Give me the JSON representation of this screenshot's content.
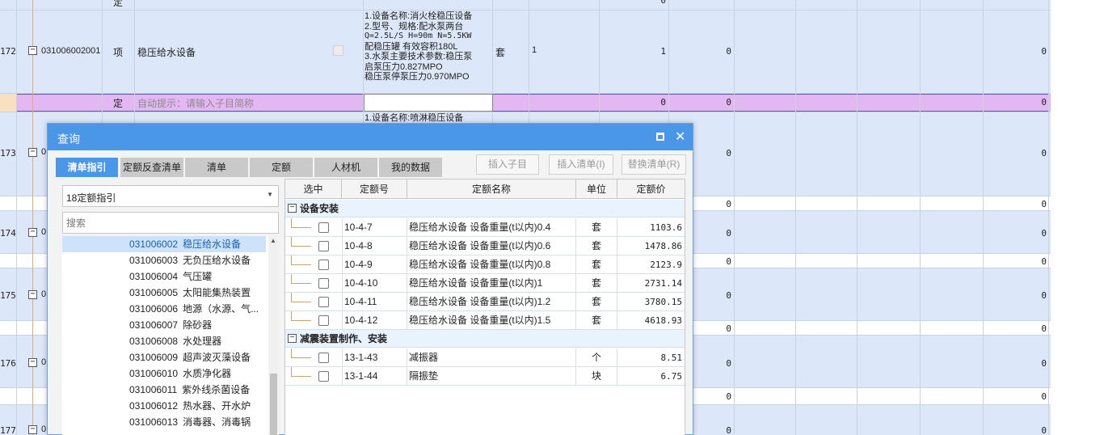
{
  "sheet": {
    "rows": [
      {
        "rownum": "172",
        "code": "031006002001",
        "type": "项",
        "name": "稳压给水设备",
        "unit": "套",
        "qty_expr": "1",
        "qty": "1",
        "price": "0",
        "total": "0",
        "desc": [
          "1.设备名称:消火栓稳压设备",
          "2.型号、规格:配水泵两台",
          "Q=2.5L/S H=90m N=5.5KW",
          "配稳压罐 有效容积180L",
          "3.水泵主要技术参数:稳压泵",
          "启泵压力0.827MPO",
          "稳压泵停泵压力0.970MPO"
        ]
      },
      {
        "type": "定",
        "hint": "自动提示：请输入子目简称",
        "qty": "0",
        "price": "0",
        "total": "0"
      },
      {
        "rownum": "173",
        "code": "0",
        "desc": [
          "1.设备名称:喷淋稳压设备"
        ],
        "price": "0",
        "total": "0"
      },
      {
        "rownum": "174",
        "code": "0",
        "price": "0",
        "total": "0"
      },
      {
        "rownum": "175",
        "code": "0",
        "price": "0",
        "total": "0"
      },
      {
        "rownum": "176",
        "code": "0",
        "price": "0",
        "total": "0"
      },
      {
        "rownum": "177",
        "code": "0",
        "price": "0",
        "total": "0"
      }
    ],
    "top_partial_type": "定",
    "top_zero": "0",
    "sub_zero": "0"
  },
  "dialog": {
    "title": "查询",
    "tabs": [
      "清单指引",
      "定额反查清单",
      "清单",
      "定额",
      "人材机",
      "我的数据"
    ],
    "buttons": [
      "插入子目",
      "插入清单(I)",
      "替换清单(R)"
    ],
    "combo_value": "18定额指引",
    "search_placeholder": "搜索",
    "tree_items": [
      {
        "code": "031006002",
        "name": "稳压给水设备"
      },
      {
        "code": "031006003",
        "name": "无负压给水设备"
      },
      {
        "code": "031006004",
        "name": "气压罐"
      },
      {
        "code": "031006005",
        "name": "太阳能集热装置"
      },
      {
        "code": "031006006",
        "name": "地源（水源、气..."
      },
      {
        "code": "031006007",
        "name": "除砂器"
      },
      {
        "code": "031006008",
        "name": "水处理器"
      },
      {
        "code": "031006009",
        "name": "超声波灭藻设备"
      },
      {
        "code": "031006010",
        "name": "水质净化器"
      },
      {
        "code": "031006011",
        "name": "紫外线杀菌设备"
      },
      {
        "code": "031006012",
        "name": "热水器、开水炉"
      },
      {
        "code": "031006013",
        "name": "消毒器、消毒锅"
      }
    ],
    "grid": {
      "headers": [
        "选中",
        "定额号",
        "定额名称",
        "单位",
        "定额价"
      ],
      "groups": [
        {
          "name": "设备安装",
          "rows": [
            {
              "code": "10-4-7",
              "name": "稳压给水设备 设备重量(t以内)0.4",
              "unit": "套",
              "price": "1103.6"
            },
            {
              "code": "10-4-8",
              "name": "稳压给水设备 设备重量(t以内)0.6",
              "unit": "套",
              "price": "1478.86"
            },
            {
              "code": "10-4-9",
              "name": "稳压给水设备 设备重量(t以内)0.8",
              "unit": "套",
              "price": "2123.9"
            },
            {
              "code": "10-4-10",
              "name": "稳压给水设备 设备重量(t以内)1",
              "unit": "套",
              "price": "2731.14"
            },
            {
              "code": "10-4-11",
              "name": "稳压给水设备 设备重量(t以内)1.2",
              "unit": "套",
              "price": "3780.15"
            },
            {
              "code": "10-4-12",
              "name": "稳压给水设备 设备重量(t以内)1.5",
              "unit": "套",
              "price": "4618.93"
            }
          ]
        },
        {
          "name": "减震装置制作、安装",
          "rows": [
            {
              "code": "13-1-43",
              "name": "减振器",
              "unit": "个",
              "price": "8.51"
            },
            {
              "code": "13-1-44",
              "name": "隔振垫",
              "unit": "块",
              "price": "6.75"
            }
          ]
        }
      ]
    }
  }
}
